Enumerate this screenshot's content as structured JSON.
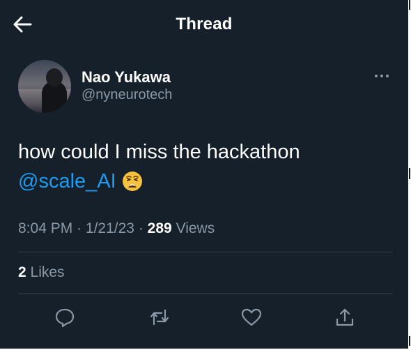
{
  "header": {
    "title": "Thread",
    "back_icon": "arrow-left-icon"
  },
  "tweet": {
    "author_name": "Nao Yukawa",
    "author_handle": "@nyneurotech",
    "text": "how could I miss the hackathon",
    "mention": "@scale_AI",
    "emoji": "weary-face-emoji",
    "time": "8:04 PM",
    "separator": "·",
    "date": "1/21/23",
    "views_count": "289",
    "views_label": "Views",
    "likes_count": "2",
    "likes_label": "Likes",
    "more_icon": "more-dots-icon"
  },
  "actions": [
    {
      "icon": "reply-icon"
    },
    {
      "icon": "retweet-icon"
    },
    {
      "icon": "heart-icon"
    },
    {
      "icon": "share-icon"
    }
  ],
  "colors": {
    "background": "#15202b",
    "text": "#ffffff",
    "secondary_text": "#8b98a5",
    "link": "#1d9bf0",
    "divider": "#38444d"
  }
}
